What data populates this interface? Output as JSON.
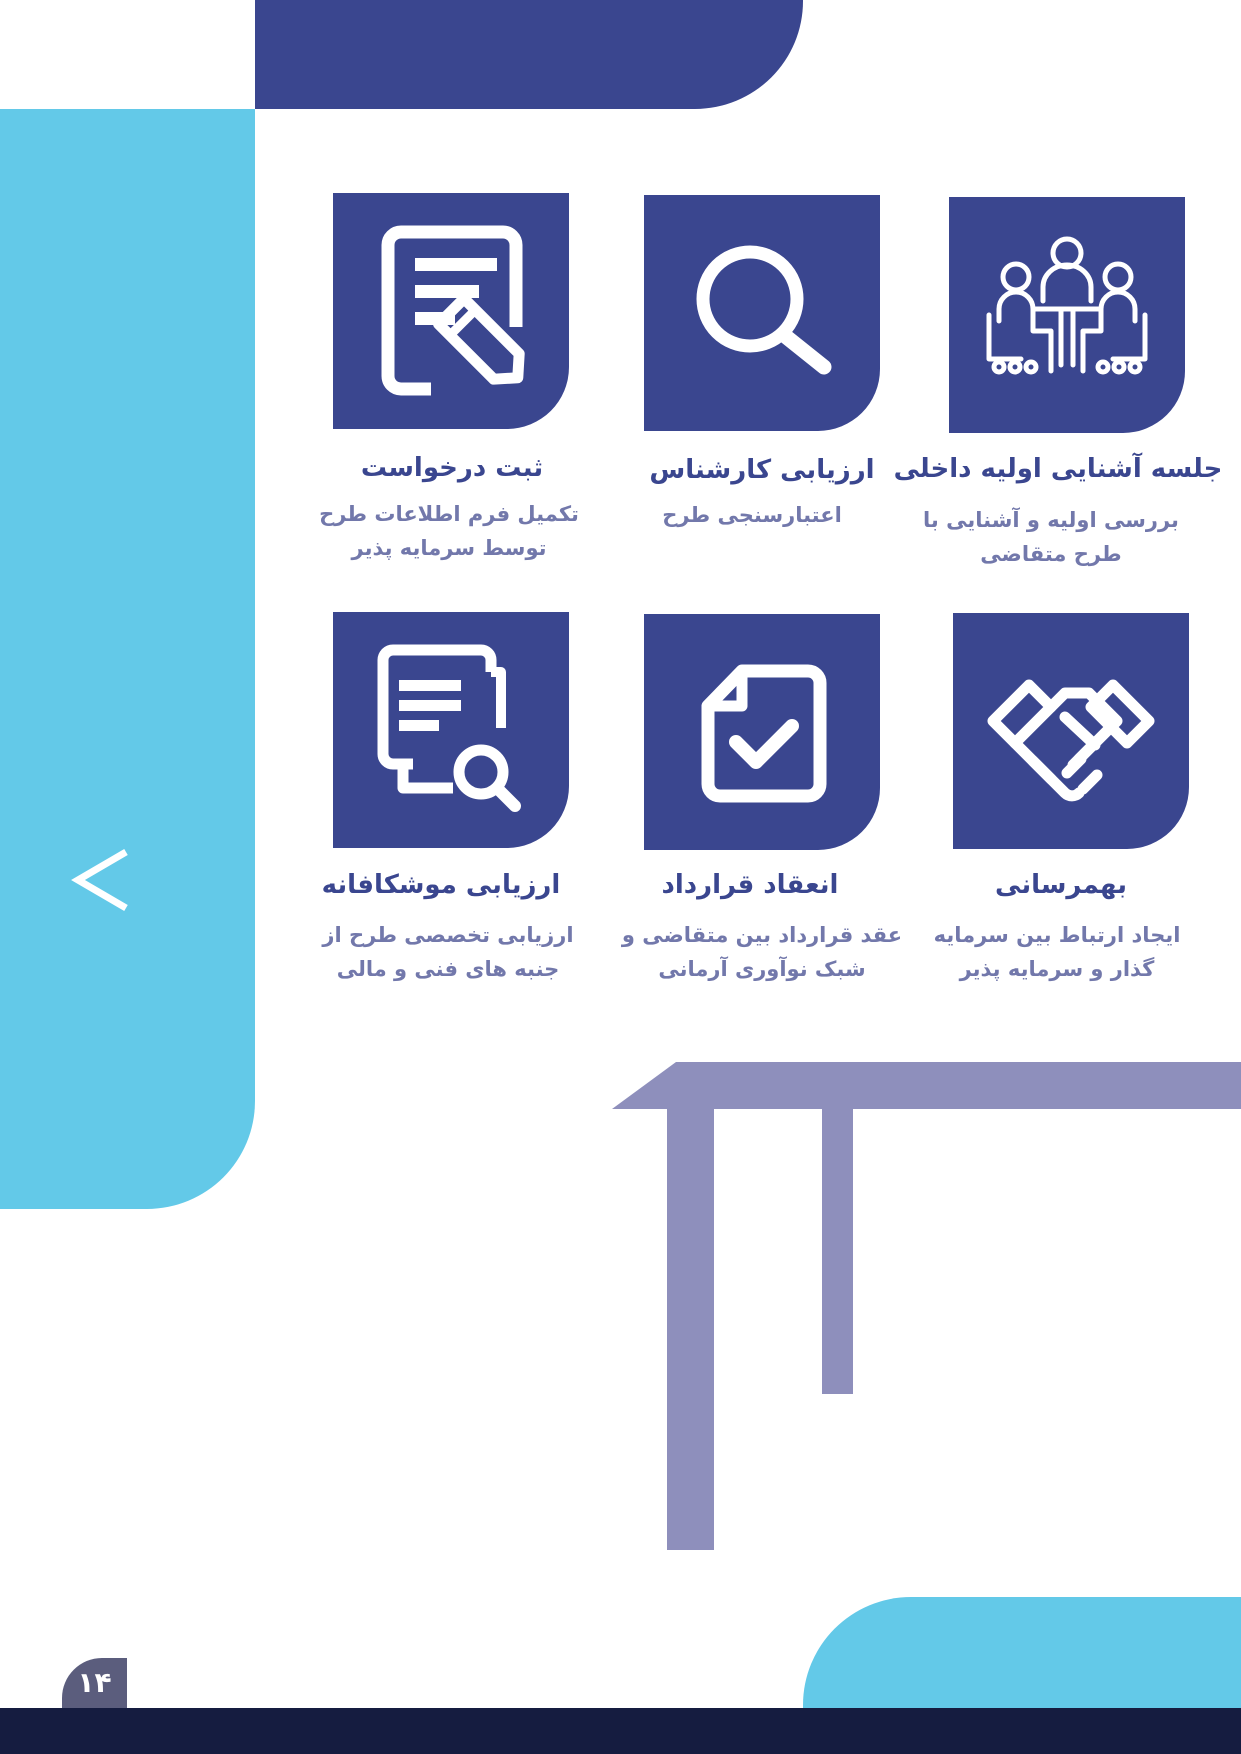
{
  "colors": {
    "navy": "#3a468f",
    "sky": "#63c9e8",
    "lavender": "#8e8fbc",
    "dark_footer": "#151c40",
    "desc_text": "#7278ab"
  },
  "side_nav": {
    "arrow_glyph": "<"
  },
  "steps": [
    {
      "icon": "meeting-icon",
      "title": "جلسه آشنایی اولیه داخلی",
      "desc": "بررسی اولیه و آشنایی با طرح متقاضی"
    },
    {
      "icon": "search-icon",
      "title": "ارزیابی کارشناس",
      "desc": "اعتبارسنجی طرح"
    },
    {
      "icon": "document-edit-icon",
      "title": "ثبت درخواست",
      "desc": "تکمیل فرم اطلاعات طرح توسط سرمایه پذیر"
    },
    {
      "icon": "handshake-icon",
      "title": "بهمرسانی",
      "desc": "ایجاد ارتباط بین سرمایه گذار و سرمایه پذیر"
    },
    {
      "icon": "contract-check-icon",
      "title": "انعقاد قرارداد",
      "desc": "عقد قرارداد بین متقاضی و شبک نوآوری آرمانی"
    },
    {
      "icon": "document-search-icon",
      "title": "ارزیابی موشکافانه",
      "desc": "ارزیابی تخصصی طرح از جنبه های فنی و مالی"
    }
  ],
  "footer": {
    "page_number": "۱۴"
  }
}
